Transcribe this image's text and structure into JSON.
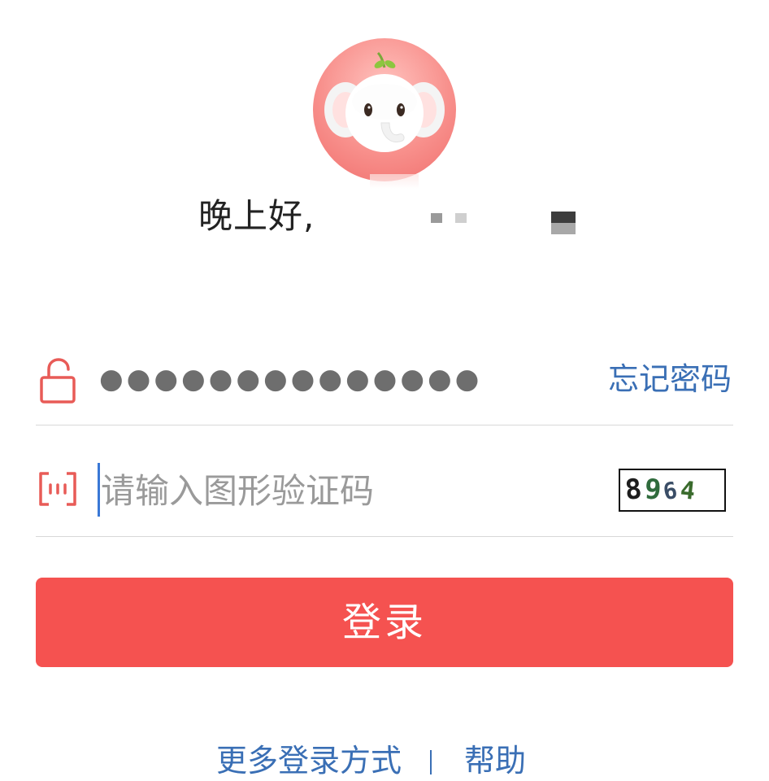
{
  "greeting": {
    "text": "晚上好,"
  },
  "password_row": {
    "icon": "lock-icon",
    "masked_value": "●●●●●●●●●●●●●●",
    "forgot_link": "忘记密码"
  },
  "captcha_row": {
    "icon": "captcha-icon",
    "placeholder": "请输入图形验证码",
    "captcha_code": [
      "8",
      "9",
      "6",
      "4"
    ]
  },
  "login_button": {
    "label": "登录"
  },
  "footer": {
    "more_login": "更多登录方式",
    "help": "帮助"
  },
  "colors": {
    "accent_red": "#f55250",
    "link_blue": "#3a6fb5",
    "icon_red": "#e85b57"
  }
}
